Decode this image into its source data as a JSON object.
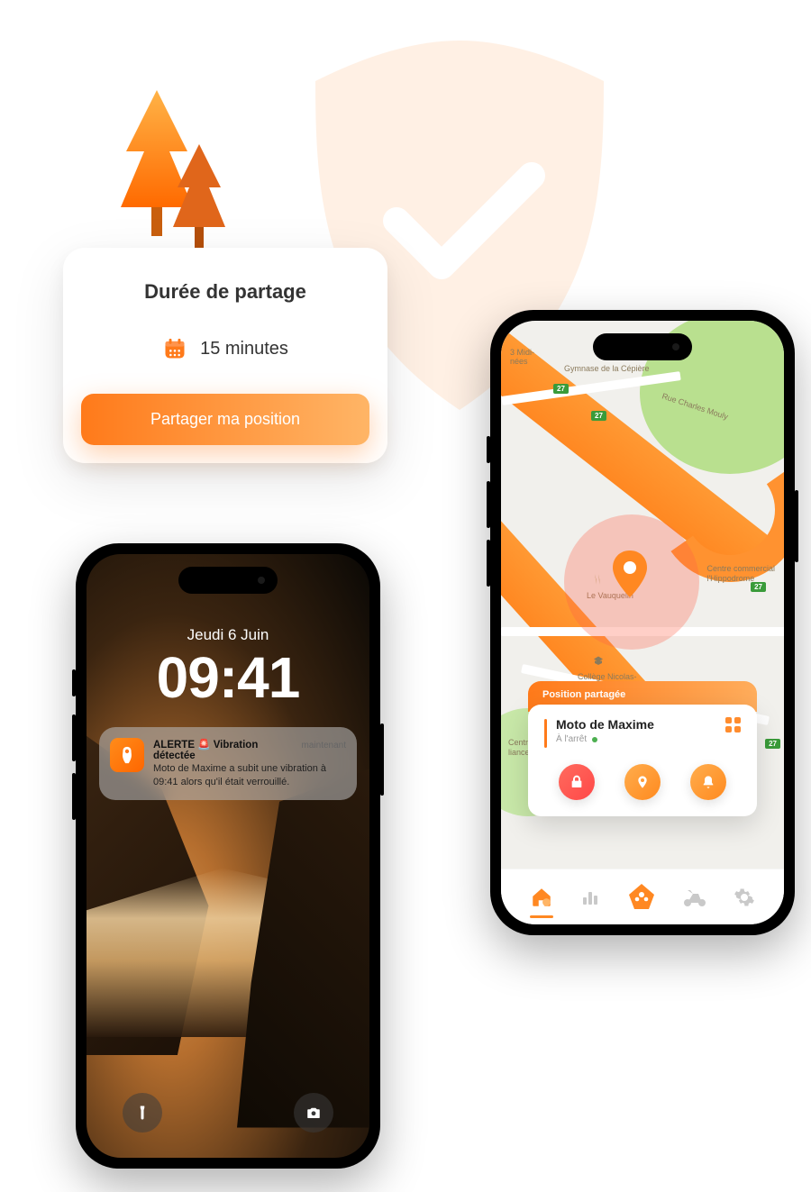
{
  "share_card": {
    "title": "Durée de partage",
    "duration": "15 minutes",
    "button": "Partager ma position"
  },
  "lock_screen": {
    "date": "Jeudi 6 Juin",
    "time": "09:41",
    "notification": {
      "title_prefix": "ALERTE",
      "title": "Vibration détectée",
      "timestamp": "maintenant",
      "body": "Moto de Maxime a subit une vibration à 09:41 alors qu'il était verrouillé."
    }
  },
  "map_screen": {
    "labels": {
      "midi": "3 Midi-\nnées",
      "gymnase": "Gymnase de la Cépière",
      "rue_mouly": "Rue Charles Mouly",
      "centre_comm": "Centre commercial\nl'Hippodrome",
      "vauquelin": "Le Vauquelin",
      "college": "Collège Nicolas-",
      "centre": "Centre :\nliances et"
    },
    "highway_badge": "27",
    "position_header": "Position partagée",
    "device": {
      "name": "Moto de Maxime",
      "status": "À l'arrêt"
    }
  },
  "colors": {
    "accent": "#ff7a1a",
    "accent_light": "#ffad5c",
    "red": "#ff5a4e",
    "green": "#4caf50"
  }
}
